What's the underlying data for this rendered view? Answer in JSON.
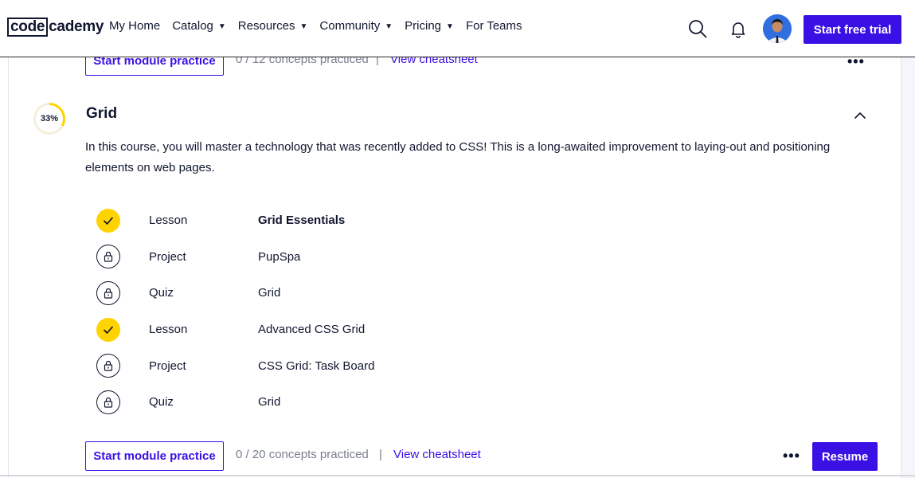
{
  "header": {
    "logo_boxed": "code",
    "logo_rest": "cademy",
    "nav": [
      {
        "label": "My Home",
        "caret": ""
      },
      {
        "label": "Catalog",
        "caret": "▼"
      },
      {
        "label": "Resources",
        "caret": "▼"
      },
      {
        "label": "Community",
        "caret": "▼"
      },
      {
        "label": "Pricing",
        "caret": "▼"
      },
      {
        "label": "For Teams",
        "caret": ""
      }
    ],
    "trial_label": "Start free trial",
    "icons": [
      "search-icon",
      "bell-icon",
      "avatar"
    ]
  },
  "previous_module": {
    "practice_label": "Start module practice",
    "concepts": "0 / 12 concepts practiced",
    "separator": "|",
    "cheatsheet_label": "View cheatsheet",
    "more": "•••"
  },
  "module": {
    "progress_label": "33%",
    "progress_value": 0.33,
    "title": "Grid",
    "description": "In this course, you will master a technology that was recently added to CSS! This is a long-awaited improvement to laying-out and positioning elements on web pages.",
    "items": [
      {
        "type": "Lesson",
        "name": "Grid Essentials",
        "status": "done",
        "current": true
      },
      {
        "type": "Project",
        "name": "PupSpa",
        "status": "locked",
        "current": false
      },
      {
        "type": "Quiz",
        "name": "Grid",
        "status": "locked",
        "current": false
      },
      {
        "type": "Lesson",
        "name": "Advanced CSS Grid",
        "status": "done",
        "current": false
      },
      {
        "type": "Project",
        "name": "CSS Grid: Task Board",
        "status": "locked",
        "current": false
      },
      {
        "type": "Quiz",
        "name": "Grid",
        "status": "locked",
        "current": false
      }
    ],
    "practice_label": "Start module practice",
    "concepts": "0 / 20 concepts practiced",
    "separator": "|",
    "cheatsheet_label": "View cheatsheet",
    "more": "•••",
    "resume_label": "Resume"
  },
  "colors": {
    "accent": "#3a10e5",
    "done": "#ffd300",
    "progress_ring": "#ffd300",
    "text": "#10162f",
    "muted": "#7a7e8f"
  }
}
